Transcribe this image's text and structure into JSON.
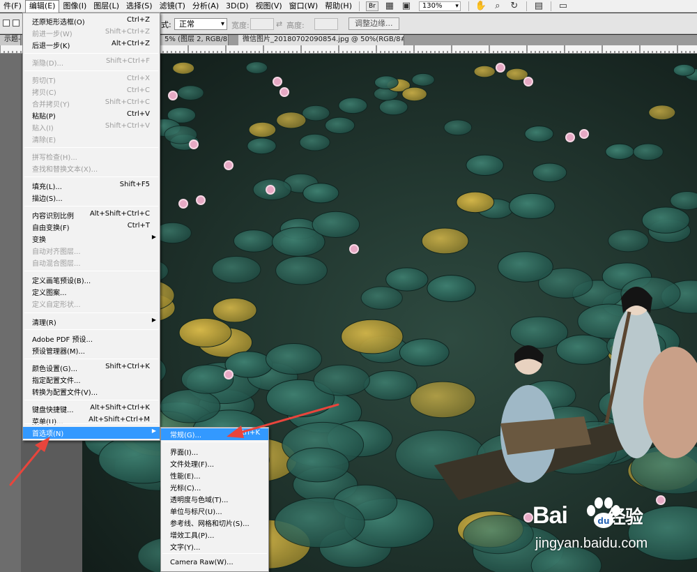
{
  "menubar": {
    "items": [
      {
        "label": "件(F)"
      },
      {
        "label": "编辑(E)"
      },
      {
        "label": "图像(I)"
      },
      {
        "label": "图层(L)"
      },
      {
        "label": "选择(S)"
      },
      {
        "label": "滤镜(T)"
      },
      {
        "label": "分析(A)"
      },
      {
        "label": "3D(D)"
      },
      {
        "label": "视图(V)"
      },
      {
        "label": "窗口(W)"
      },
      {
        "label": "帮助(H)"
      }
    ],
    "active_index": 1,
    "bridge_label": "Br",
    "zoom": "130%"
  },
  "options_bar": {
    "mode_suffix": "式:",
    "style_value": "正常",
    "width_label": "宽度:",
    "height_label": "高度:",
    "refine_edge_button": "调整边缘..."
  },
  "tabs": [
    {
      "label": "示题-1"
    },
    {
      "label": "5% (图层 2, RGB/8) *"
    },
    {
      "label": "微信图片_20180702090854.jpg @ 50%(RGB/8#) *"
    }
  ],
  "edit_menu": {
    "items": [
      {
        "label": "还原矩形选框(O)",
        "shortcut": "Ctrl+Z",
        "disabled": false
      },
      {
        "label": "前进一步(W)",
        "shortcut": "Shift+Ctrl+Z",
        "disabled": true
      },
      {
        "label": "后退一步(K)",
        "shortcut": "Alt+Ctrl+Z",
        "disabled": false
      },
      {
        "label": "渐隐(D)...",
        "shortcut": "Shift+Ctrl+F",
        "disabled": true
      },
      {
        "label": "剪切(T)",
        "shortcut": "Ctrl+X",
        "disabled": true
      },
      {
        "label": "拷贝(C)",
        "shortcut": "Ctrl+C",
        "disabled": true
      },
      {
        "label": "合并拷贝(Y)",
        "shortcut": "Shift+Ctrl+C",
        "disabled": true
      },
      {
        "label": "粘贴(P)",
        "shortcut": "Ctrl+V",
        "disabled": false
      },
      {
        "label": "贴入(I)",
        "shortcut": "Shift+Ctrl+V",
        "disabled": true
      },
      {
        "label": "清除(E)",
        "shortcut": "",
        "disabled": true
      },
      {
        "label": "拼写检查(H)...",
        "shortcut": "",
        "disabled": true
      },
      {
        "label": "查找和替换文本(X)...",
        "shortcut": "",
        "disabled": true
      },
      {
        "label": "填充(L)...",
        "shortcut": "Shift+F5",
        "disabled": false
      },
      {
        "label": "描边(S)...",
        "shortcut": "",
        "disabled": false
      },
      {
        "label": "内容识别比例",
        "shortcut": "Alt+Shift+Ctrl+C",
        "disabled": false
      },
      {
        "label": "自由变换(F)",
        "shortcut": "Ctrl+T",
        "disabled": false
      },
      {
        "label": "变换",
        "shortcut": "",
        "disabled": false,
        "submenu": true
      },
      {
        "label": "自动对齐图层...",
        "shortcut": "",
        "disabled": true
      },
      {
        "label": "自动混合图层...",
        "shortcut": "",
        "disabled": true
      },
      {
        "label": "定义画笔预设(B)...",
        "shortcut": "",
        "disabled": false
      },
      {
        "label": "定义图案...",
        "shortcut": "",
        "disabled": false
      },
      {
        "label": "定义自定形状...",
        "shortcut": "",
        "disabled": true
      },
      {
        "label": "清理(R)",
        "shortcut": "",
        "disabled": false,
        "submenu": true
      },
      {
        "label": "Adobe PDF 预设...",
        "shortcut": "",
        "disabled": false
      },
      {
        "label": "预设管理器(M)...",
        "shortcut": "",
        "disabled": false
      },
      {
        "label": "颜色设置(G)...",
        "shortcut": "Shift+Ctrl+K",
        "disabled": false
      },
      {
        "label": "指定配置文件...",
        "shortcut": "",
        "disabled": false
      },
      {
        "label": "转换为配置文件(V)...",
        "shortcut": "",
        "disabled": false
      },
      {
        "label": "键盘快捷键...",
        "shortcut": "Alt+Shift+Ctrl+K",
        "disabled": false
      },
      {
        "label": "菜单(U)...",
        "shortcut": "Alt+Shift+Ctrl+M",
        "disabled": false
      },
      {
        "label": "首选项(N)",
        "shortcut": "",
        "disabled": false,
        "submenu": true,
        "highlighted": true
      }
    ]
  },
  "preferences_submenu": {
    "items": [
      {
        "label": "常规(G)...",
        "shortcut": "Ctrl+K",
        "highlighted": true
      },
      {
        "label": "界面(I)...",
        "shortcut": ""
      },
      {
        "label": "文件处理(F)...",
        "shortcut": ""
      },
      {
        "label": "性能(E)...",
        "shortcut": ""
      },
      {
        "label": "光标(C)...",
        "shortcut": ""
      },
      {
        "label": "透明度与色域(T)...",
        "shortcut": ""
      },
      {
        "label": "单位与标尺(U)...",
        "shortcut": ""
      },
      {
        "label": "参考线、网格和切片(S)...",
        "shortcut": ""
      },
      {
        "label": "增效工具(P)...",
        "shortcut": ""
      },
      {
        "label": "文字(Y)...",
        "shortcut": ""
      },
      {
        "label": "Camera Raw(W)...",
        "shortcut": ""
      }
    ]
  },
  "watermark": {
    "logo_text": "Bai",
    "logo_suffix": "经验",
    "site": "jingyan.baidu.com"
  },
  "colors": {
    "highlight": "#3399ff",
    "arrow": "#e8453c"
  }
}
